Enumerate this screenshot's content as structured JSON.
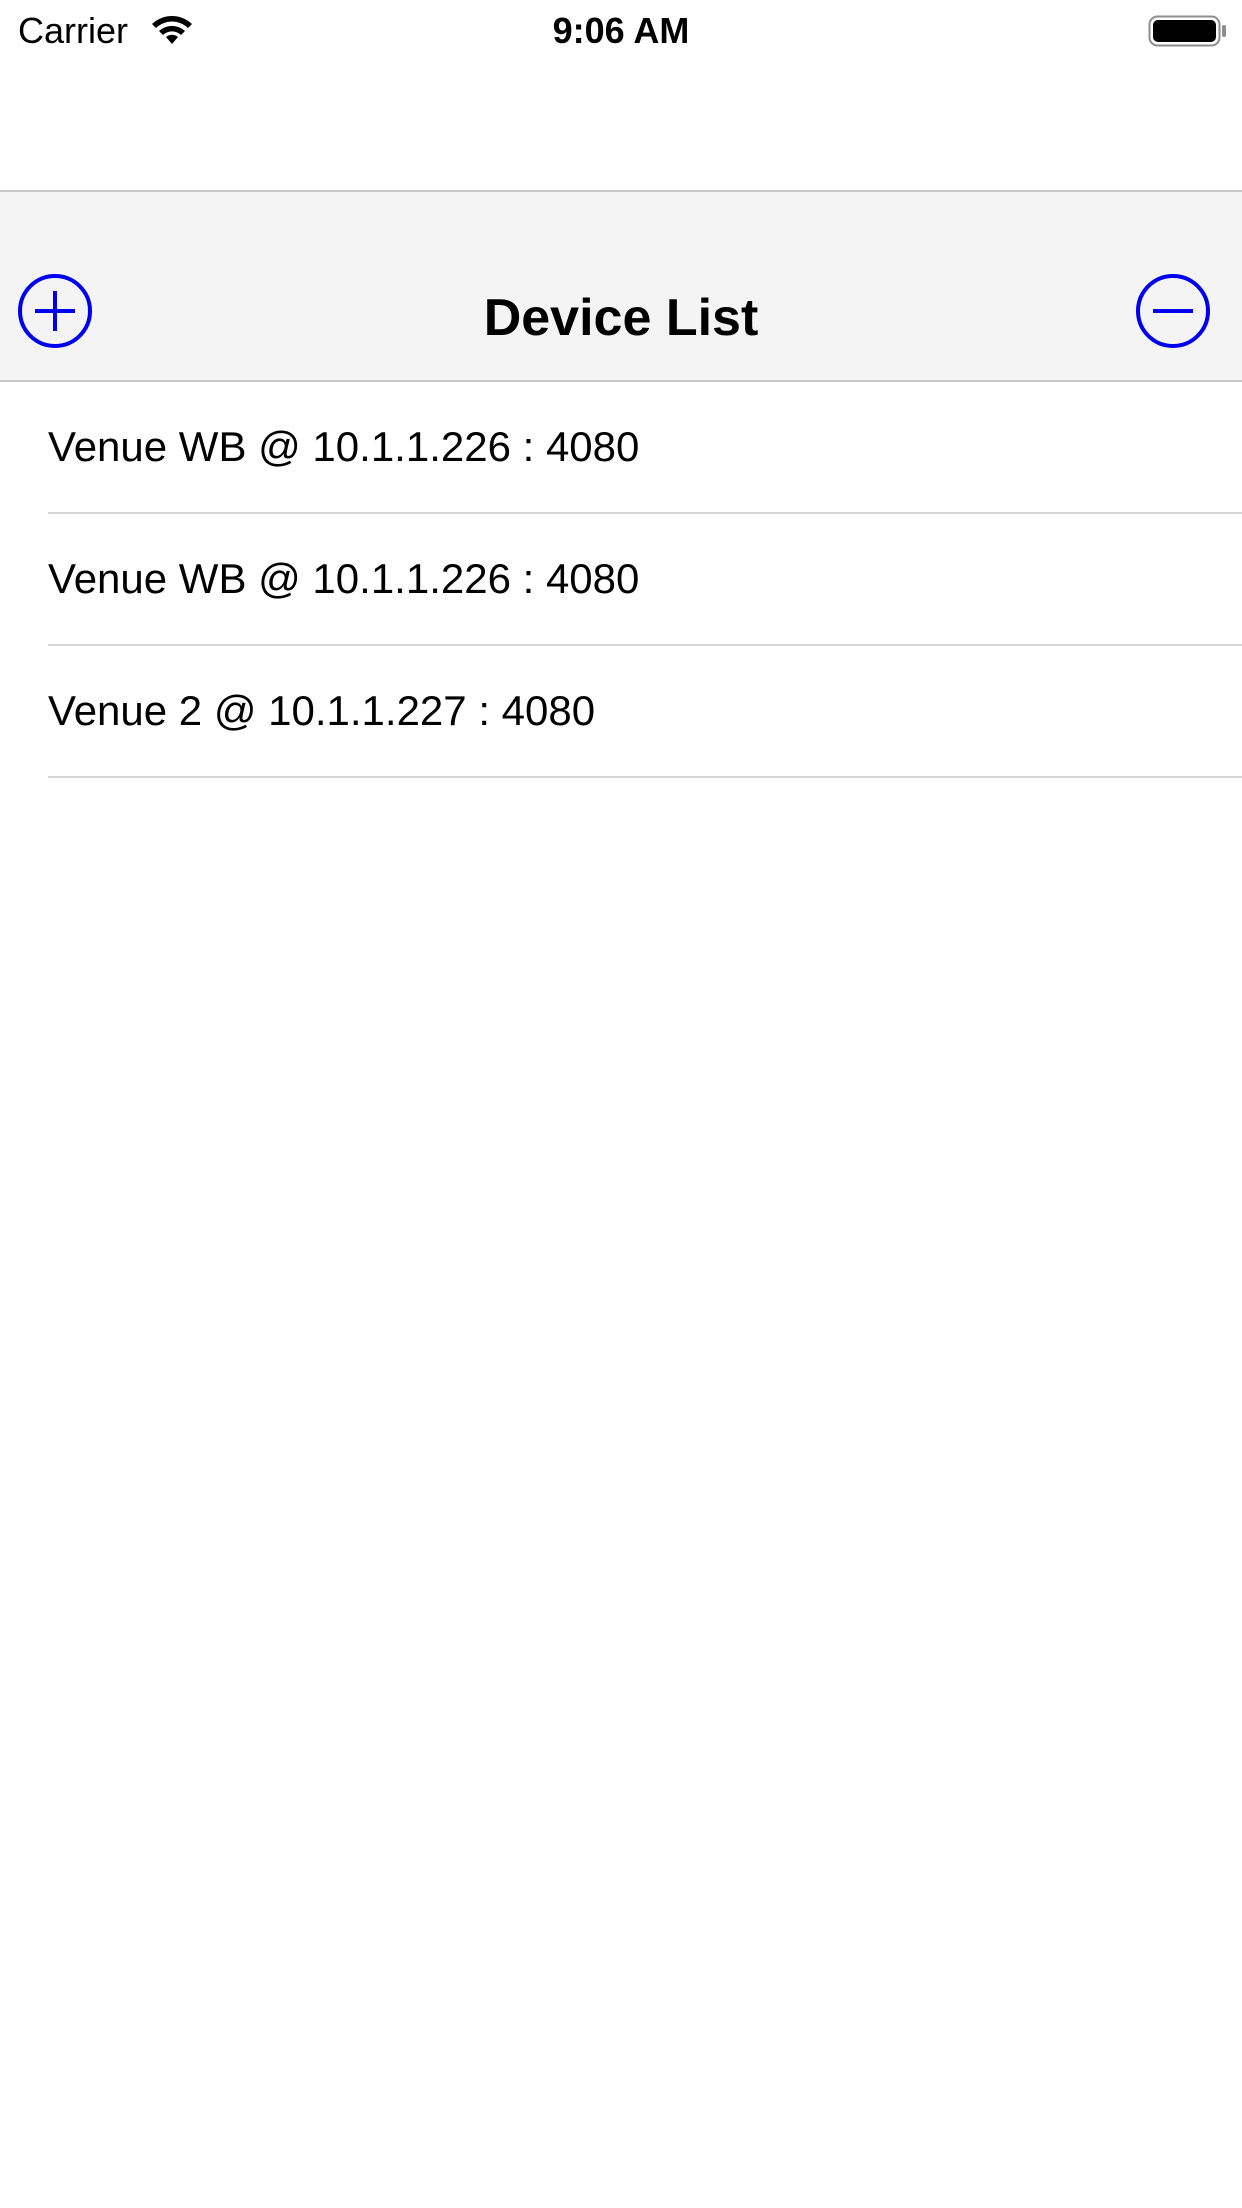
{
  "status_bar": {
    "carrier": "Carrier",
    "time": "9:06 AM",
    "wifi_icon": "wifi-icon",
    "battery_icon": "battery-icon"
  },
  "nav_bar": {
    "title": "Device List",
    "add_icon": "plus-circle-icon",
    "remove_icon": "minus-circle-icon",
    "accent_color": "#0000ee"
  },
  "devices": [
    {
      "label": "Venue WB @ 10.1.1.226 : 4080"
    },
    {
      "label": "Venue WB @ 10.1.1.226 : 4080"
    },
    {
      "label": "Venue 2 @ 10.1.1.227 : 4080"
    }
  ]
}
